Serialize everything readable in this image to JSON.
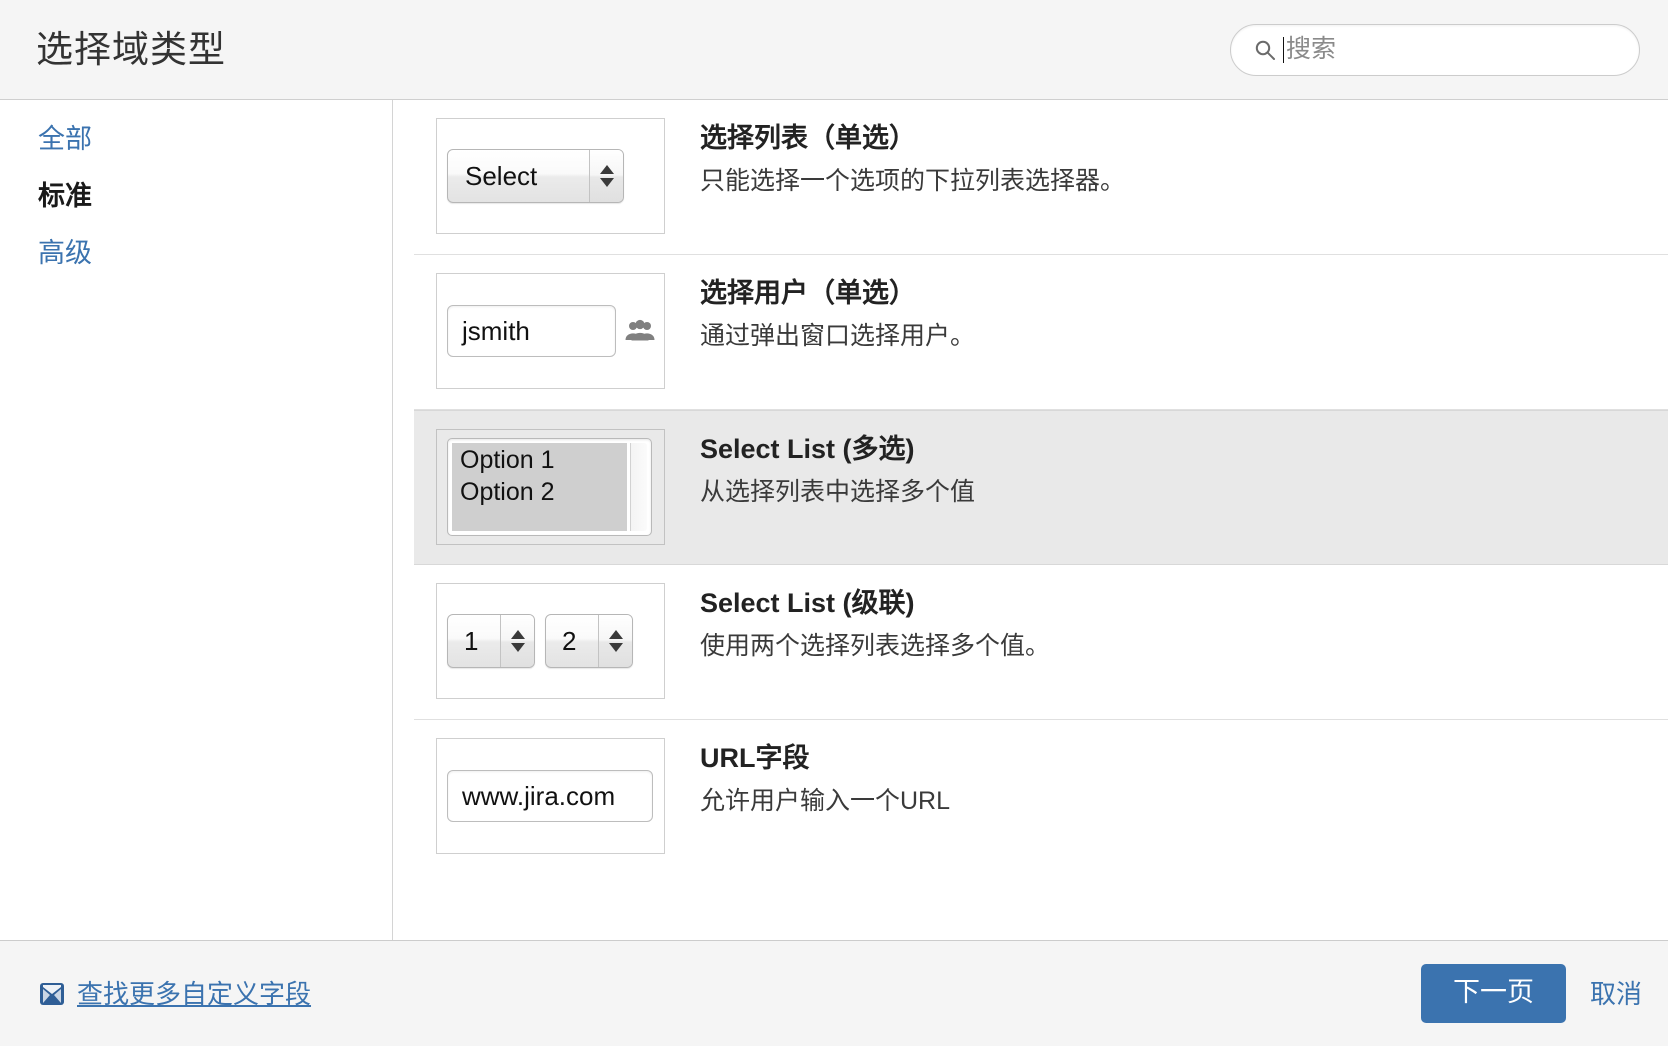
{
  "header": {
    "title": "选择域类型",
    "search": {
      "placeholder": "搜索",
      "icon": "search-icon"
    }
  },
  "sidebar": {
    "items": [
      {
        "label": "全部",
        "active": false
      },
      {
        "label": "标准",
        "active": true
      },
      {
        "label": "高级",
        "active": false
      }
    ]
  },
  "field_types": [
    {
      "title": "选择列表（单选）",
      "description": "只能选择一个选项的下拉列表选择器。",
      "selected": false,
      "preview": {
        "kind": "select",
        "value": "Select"
      }
    },
    {
      "title": "选择用户（单选）",
      "description": "通过弹出窗口选择用户。",
      "selected": false,
      "preview": {
        "kind": "user",
        "value": "jsmith",
        "icon": "users-icon"
      }
    },
    {
      "title": "Select List (多选)",
      "description": "从选择列表中选择多个值",
      "selected": true,
      "preview": {
        "kind": "multiselect",
        "options": [
          "Option 1",
          "Option 2"
        ]
      }
    },
    {
      "title": "Select List (级联)",
      "description": "使用两个选择列表选择多个值。",
      "selected": false,
      "preview": {
        "kind": "cascade",
        "values": [
          "1",
          "2"
        ]
      }
    },
    {
      "title": "URL字段",
      "description": "允许用户输入一个URL",
      "selected": false,
      "preview": {
        "kind": "url",
        "value": "www.jira.com"
      }
    }
  ],
  "footer": {
    "marketplace_link": "查找更多自定义字段",
    "marketplace_icon": "marketplace-plugin-icon",
    "next_button": "下一页",
    "cancel_link": "取消"
  },
  "colors": {
    "accent": "#3b73af",
    "link": "#3b73af",
    "header_bg": "#f5f5f5",
    "selected_row_bg": "#e9e9e9"
  }
}
